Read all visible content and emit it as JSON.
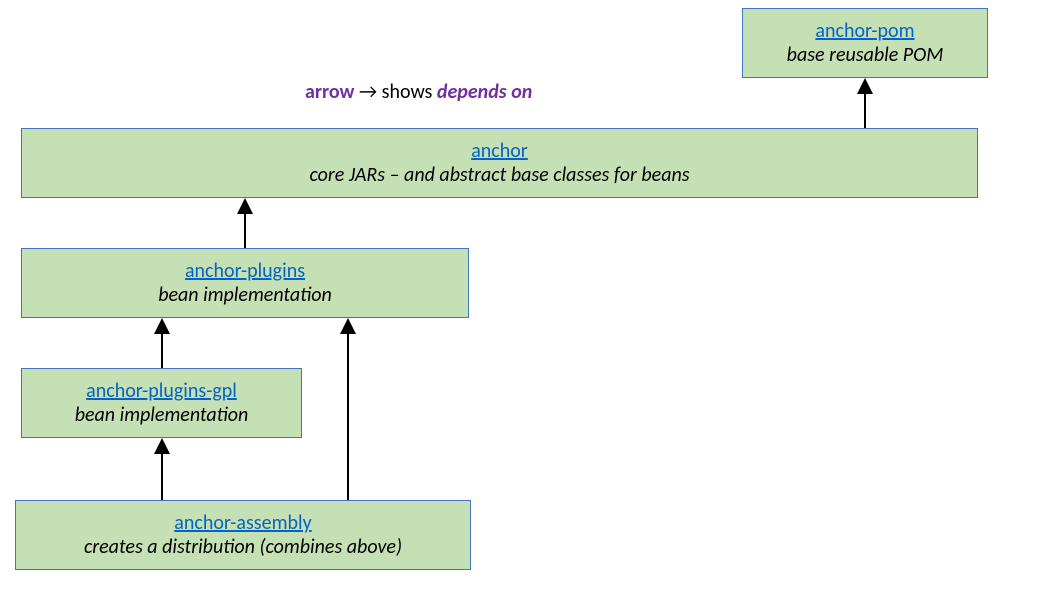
{
  "legend": {
    "arrow_word": "arrow",
    "symbol": "→",
    "shows": "shows",
    "depends": "depends on"
  },
  "boxes": {
    "anchor_pom": {
      "title": "anchor-pom",
      "subtitle": "base reusable POM"
    },
    "anchor": {
      "title": "anchor",
      "subtitle": "core JARs – and abstract base classes for beans"
    },
    "anchor_plugins": {
      "title": "anchor-plugins",
      "subtitle": "bean implementation"
    },
    "anchor_plugins_gpl": {
      "title": "anchor-plugins-gpl",
      "subtitle": "bean implementation"
    },
    "anchor_assembly": {
      "title": "anchor-assembly",
      "subtitle": "creates a distribution (combines above)"
    }
  }
}
